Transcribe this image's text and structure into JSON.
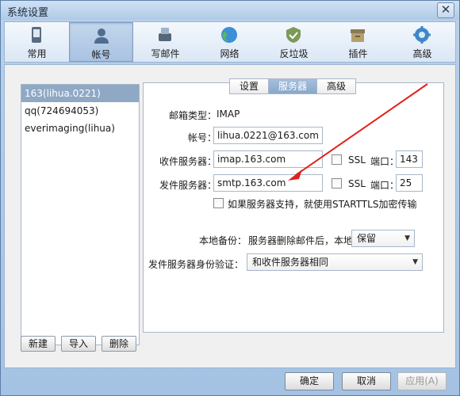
{
  "window": {
    "title": "系统设置",
    "close": "✕"
  },
  "toolbar": [
    {
      "label": "常用",
      "icon": "phone-icon"
    },
    {
      "label": "帐号",
      "icon": "user-icon"
    },
    {
      "label": "写邮件",
      "icon": "writer-icon"
    },
    {
      "label": "网络",
      "icon": "globe-icon"
    },
    {
      "label": "反垃圾",
      "icon": "shield-icon"
    },
    {
      "label": "插件",
      "icon": "box-icon"
    },
    {
      "label": "高级",
      "icon": "gear-icon"
    }
  ],
  "accounts": [
    "163(lihua.0221)",
    "qq(724694053)",
    "everimaging(lihua)"
  ],
  "list_buttons": {
    "new": "新建",
    "import": "导入",
    "delete": "删除"
  },
  "tabs": [
    "设置",
    "服务器",
    "高级"
  ],
  "form": {
    "type_label": "邮箱类型：",
    "type_value": "IMAP",
    "account_label": "帐号：",
    "account_value": "lihua.0221@163.com",
    "recv_label": "收件服务器：",
    "recv_value": "imap.163.com",
    "send_label": "发件服务器：",
    "send_value": "smtp.163.com",
    "ssl_label": "SSL",
    "port_label": "端口：",
    "recv_port": "143",
    "send_port": "25",
    "starttls_label": "如果服务器支持，就使用STARTTLS加密传输",
    "backup_label": "本地备份：",
    "backup_text": "服务器删除邮件后，本地",
    "backup_value": "保留",
    "auth_label": "发件服务器身份验证：",
    "auth_value": "和收件服务器相同"
  },
  "footer": {
    "ok": "确定",
    "cancel": "取消",
    "apply": "应用(A)"
  },
  "colors": {
    "annotation_arrow": "#e0201b",
    "selection": "#8fa8c4"
  }
}
